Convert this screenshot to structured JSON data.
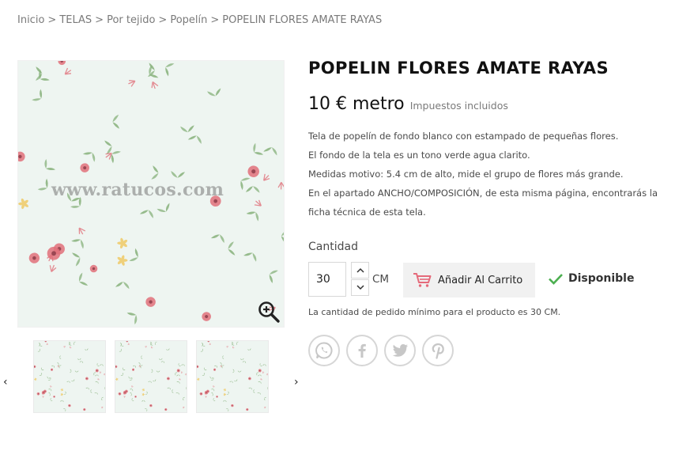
{
  "breadcrumb": {
    "items": [
      "Inicio",
      "TELAS",
      "Por tejido",
      "Popelín",
      "POPELIN FLORES AMATE RAYAS"
    ],
    "separator": ">"
  },
  "product": {
    "title": "POPELIN FLORES AMATE RAYAS",
    "price": "10 € metro",
    "tax_note": "Impuestos incluidos",
    "description": [
      "Tela de popelín de fondo blanco con estampado de pequeñas flores.",
      "El fondo de la tela es un tono verde agua clarito.",
      "Medidas motivo: 5.4 cm de alto, mide el grupo de flores más grande.",
      "En el apartado ANCHO/COMPOSICIÓN, de esta misma página, encontrarás la ficha técnica de esta tela."
    ],
    "image_watermark": "www.ratucos.com"
  },
  "purchase": {
    "quantity_label": "Cantidad",
    "quantity_value": "30",
    "unit": "CM",
    "add_to_cart_label": "Añadir Al Carrito",
    "availability": "Disponible",
    "min_note": "La cantidad de pedido mínimo para el producto es 30 CM."
  },
  "thumbnails": {
    "count": 3,
    "prev": "‹",
    "next": "›"
  },
  "social": [
    "whatsapp-icon",
    "facebook-icon",
    "twitter-icon",
    "pinterest-icon"
  ],
  "colors": {
    "fabric_background": "#eef5f1",
    "flower_red": "#e0707a",
    "flower_yellow": "#efd07a",
    "leaf_green": "#86b07a",
    "availability_check": "#4caf50",
    "cart_icon": "#e56a7a",
    "text_dark": "#232323",
    "text_muted": "#7a7a7a"
  }
}
